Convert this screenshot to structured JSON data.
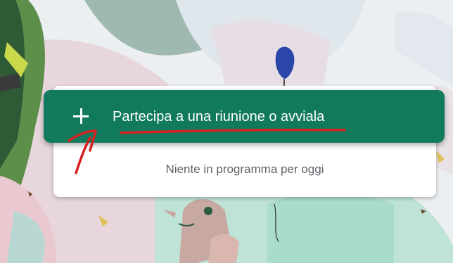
{
  "meet_home": {
    "join_button_label": "Partecipa a una riunione o avviala",
    "join_button_icon": "plus-icon",
    "empty_schedule_text": "Niente in programma per oggi"
  },
  "colors": {
    "accent_green": "#117a5c",
    "card_background": "#ffffff",
    "secondary_text": "#5f6368",
    "annotation_red": "#d62020"
  }
}
